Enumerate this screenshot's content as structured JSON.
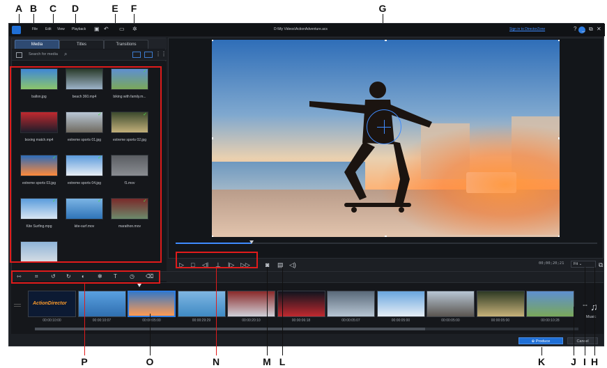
{
  "callouts": {
    "top": [
      "A",
      "B",
      "C",
      "D",
      "E",
      "F",
      "G"
    ],
    "bottom": [
      "P",
      "O",
      "N",
      "M",
      "L",
      "K",
      "J",
      "I",
      "H"
    ]
  },
  "window": {
    "title": "D:\\My Videos\\ActionAdventure.acs",
    "menu": [
      "File",
      "Edit",
      "View",
      "Playback"
    ],
    "sign_in": "Sign in to DirectorZone",
    "help": "?",
    "minimize": "_",
    "restore": "⧉",
    "close": "✕"
  },
  "library": {
    "tabs": [
      "Media",
      "Titles",
      "Transitions"
    ],
    "active_tab": "Media",
    "search_placeholder": "Search for media",
    "items": [
      {
        "name": "ballon.jpg",
        "checked": false,
        "colors": [
          "#3f87d6",
          "#8cc66a"
        ]
      },
      {
        "name": "beach 360.mp4",
        "checked": false,
        "colors": [
          "#2a3b2a",
          "#9db3c9"
        ]
      },
      {
        "name": "biking with family.m...",
        "checked": true,
        "colors": [
          "#5e8fd0",
          "#7aa85a"
        ]
      },
      {
        "name": "boxing match.mp4",
        "checked": false,
        "colors": [
          "#c0292f",
          "#1d1d2a"
        ]
      },
      {
        "name": "extreme sports 01.jpg",
        "checked": true,
        "colors": [
          "#b9c7d6",
          "#6f6a60"
        ]
      },
      {
        "name": "extreme sports 02.jpg",
        "checked": true,
        "colors": [
          "#3c4a2e",
          "#c2b07a"
        ]
      },
      {
        "name": "extreme sports 03.jpg",
        "checked": true,
        "colors": [
          "#2d6bb8",
          "#ff8a3a"
        ]
      },
      {
        "name": "extreme sports 04.jpg",
        "checked": true,
        "colors": [
          "#5b9bdc",
          "#e8eef5"
        ]
      },
      {
        "name": "f1.mov",
        "checked": false,
        "colors": [
          "#5a5d62",
          "#8a8d92"
        ]
      },
      {
        "name": "Kite Surfing.mpg",
        "checked": true,
        "colors": [
          "#5a9cdc",
          "#d8e6f2"
        ]
      },
      {
        "name": "kite-surf.mov",
        "checked": true,
        "colors": [
          "#7bb4e4",
          "#2f74b8"
        ]
      },
      {
        "name": "marathon.mov",
        "checked": true,
        "colors": [
          "#7a2a2a",
          "#6c8a6c"
        ]
      },
      {
        "name": "",
        "checked": false,
        "colors": [
          "#8fb4d8",
          "#d6dde4"
        ]
      }
    ]
  },
  "preview": {
    "timecode": "00;00;20;21",
    "fit": "Fit",
    "progress": 0.18
  },
  "timeline": {
    "clips": [
      {
        "time": "00:00:10:00",
        "title": "ActionDirector",
        "colors": [
          "#0c1a33",
          "#0c1a33"
        ],
        "selected": false
      },
      {
        "time": "00:00:10:07",
        "title": "",
        "colors": [
          "#5aa0e0",
          "#2f6fb0"
        ],
        "selected": false
      },
      {
        "time": "00:00:05:00",
        "title": "",
        "colors": [
          "#3a78c2",
          "#ff9a52"
        ],
        "selected": true
      },
      {
        "time": "00:00:29:29",
        "title": "",
        "colors": [
          "#7fb6e2",
          "#3f8ac4"
        ],
        "selected": false
      },
      {
        "time": "00:00:20:10",
        "title": "",
        "colors": [
          "#8a2a2a",
          "#d0d0d8"
        ],
        "selected": false
      },
      {
        "time": "00:00:06:18",
        "title": "",
        "colors": [
          "#10141e",
          "#c0292f"
        ],
        "selected": false
      },
      {
        "time": "00:00:05:07",
        "title": "",
        "colors": [
          "#5a6a7a",
          "#b8c6d4"
        ],
        "selected": false
      },
      {
        "time": "00:00:05:00",
        "title": "",
        "colors": [
          "#6aa6de",
          "#e6eef6"
        ],
        "selected": false
      },
      {
        "time": "00:00:05:00",
        "title": "",
        "colors": [
          "#b8c6d4",
          "#5a5550"
        ],
        "selected": false
      },
      {
        "time": "00:00:05:00",
        "title": "",
        "colors": [
          "#2e3a24",
          "#c7b27a"
        ],
        "selected": false
      },
      {
        "time": "00:00:10:28",
        "title": "",
        "colors": [
          "#5e8fd0",
          "#7aa85a"
        ],
        "selected": false
      }
    ],
    "music_label": "Music"
  },
  "actions": {
    "produce": "Produce",
    "cancel": "Cancel"
  },
  "colors": {
    "accent": "#1f6fd6",
    "highlight": "#e01b1b",
    "check": "#4fd64f"
  }
}
